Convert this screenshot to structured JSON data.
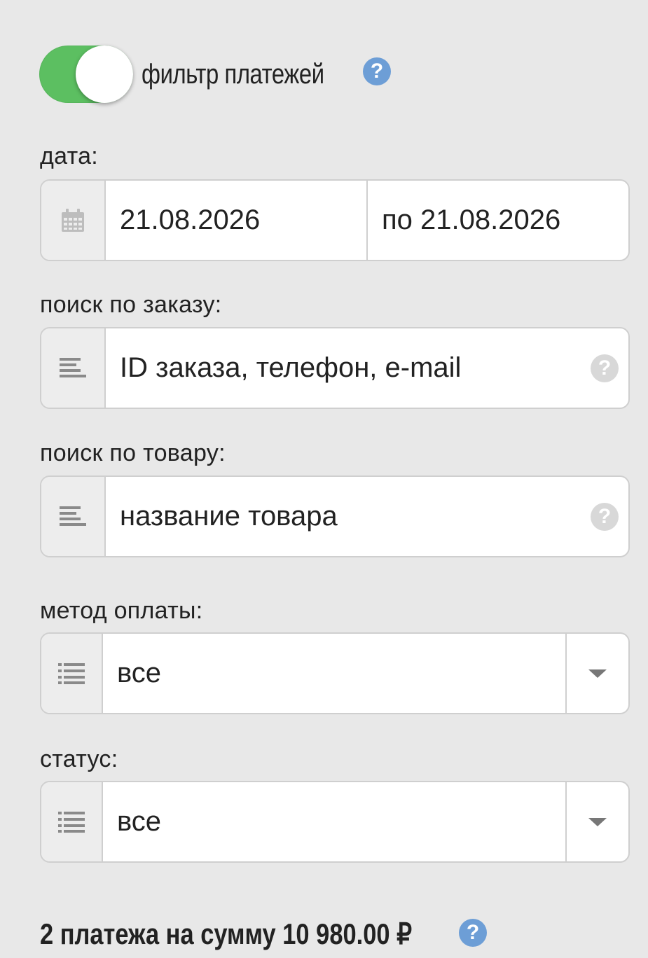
{
  "filter": {
    "label": "фильтр платежей",
    "enabled": true,
    "help_icon": "question-icon"
  },
  "date": {
    "label": "дата:",
    "from_value": "21.08.2026",
    "to_placeholder": "по 21.08.2026",
    "icon": "calendar-icon"
  },
  "order_search": {
    "label": "поиск по заказу:",
    "placeholder": "ID заказа, телефон, e-mail",
    "icon": "text-lines-icon"
  },
  "product_search": {
    "label": "поиск по товару:",
    "placeholder": "название товара",
    "icon": "text-lines-icon"
  },
  "payment_method": {
    "label": "метод оплаты:",
    "value": "все",
    "icon": "list-icon"
  },
  "status": {
    "label": "статус:",
    "value": "все",
    "icon": "list-icon"
  },
  "summary": {
    "text": "2 платежа на сумму 10 980.00 ₽"
  },
  "colors": {
    "toggle_on": "#5cbf61",
    "help_blue": "#6d9ed6",
    "background": "#e8e8e8"
  }
}
